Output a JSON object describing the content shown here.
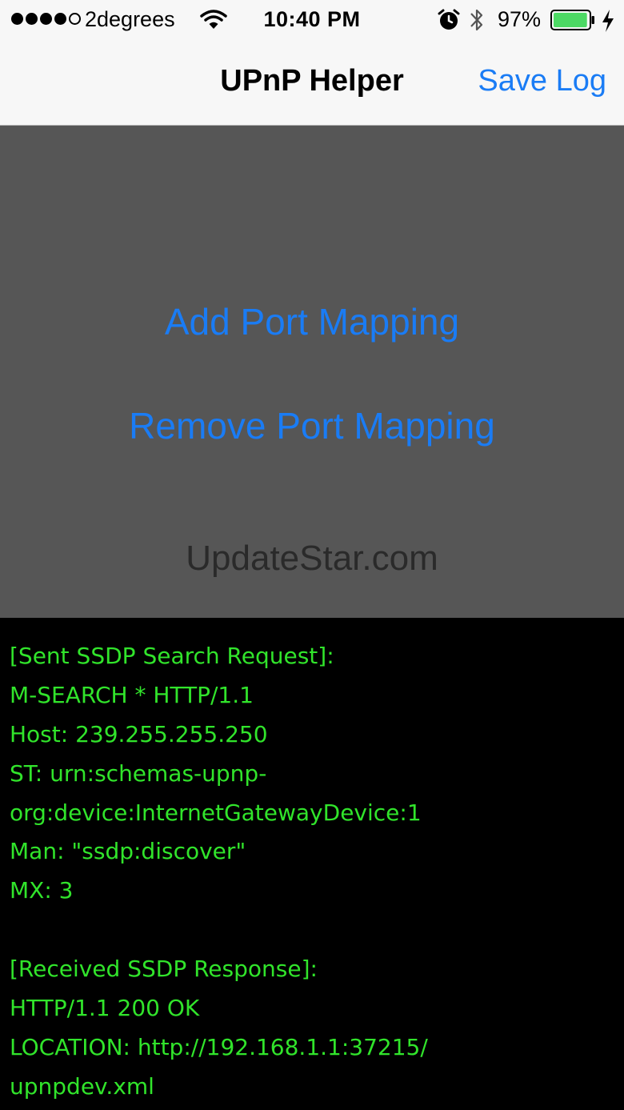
{
  "status_bar": {
    "carrier": "2degrees",
    "time": "10:40 PM",
    "battery_percent": "97%",
    "battery_level": 0.97,
    "signal_strength": 4,
    "signal_max": 5,
    "icons": [
      "signal-dots-icon",
      "wifi-icon",
      "alarm-icon",
      "bluetooth-icon",
      "battery-icon",
      "charging-bolt-icon"
    ],
    "battery_color": "#4cd964"
  },
  "nav": {
    "title": "UPnP Helper",
    "save_log_label": "Save Log"
  },
  "actions": {
    "add_label": "Add Port Mapping",
    "remove_label": "Remove Port Mapping"
  },
  "watermark": "UpdateStar.com",
  "log": {
    "lines": [
      "[Sent SSDP Search Request]:",
      "M-SEARCH * HTTP/1.1",
      "Host: 239.255.255.250",
      "ST: urn:schemas-upnp-",
      "org:device:InternetGatewayDevice:1",
      "Man: \"ssdp:discover\"",
      "MX: 3",
      "",
      "[Received SSDP Response]:",
      "HTTP/1.1 200 OK",
      "LOCATION: http://192.168.1.1:37215/",
      "upnpdev.xml"
    ]
  },
  "colors": {
    "accent": "#1a7cf5",
    "log_text": "#31e42b",
    "panel_bg": "#565656",
    "log_bg": "#000000"
  }
}
